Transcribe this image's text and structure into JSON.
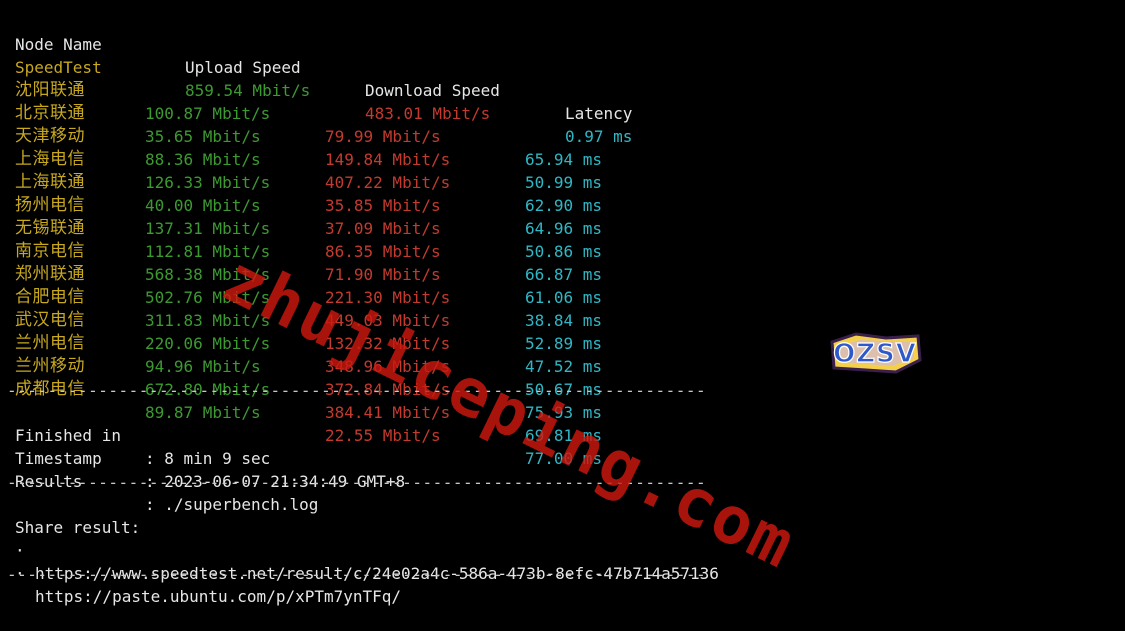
{
  "divider": "-------------------------------------------------------------------------------",
  "headers": {
    "node_name": "Node Name",
    "upload_speed": "Upload Speed",
    "download_speed": "Download Speed",
    "latency": "Latency"
  },
  "rows": [
    {
      "node": "SpeedTest",
      "upload": "859.54 Mbit/s",
      "download": "483.01 Mbit/s",
      "latency": "0.97 ms"
    },
    {
      "node": "沈阳联通",
      "upload": "100.87 Mbit/s",
      "download": "79.99 Mbit/s",
      "latency": "65.94 ms"
    },
    {
      "node": "北京联通",
      "upload": "35.65 Mbit/s",
      "download": "149.84 Mbit/s",
      "latency": "50.99 ms"
    },
    {
      "node": "天津移动",
      "upload": "88.36 Mbit/s",
      "download": "407.22 Mbit/s",
      "latency": "62.90 ms"
    },
    {
      "node": "上海电信",
      "upload": "126.33 Mbit/s",
      "download": "35.85 Mbit/s",
      "latency": "64.96 ms"
    },
    {
      "node": "上海联通",
      "upload": "40.00 Mbit/s",
      "download": "37.09 Mbit/s",
      "latency": "50.86 ms"
    },
    {
      "node": "扬州电信",
      "upload": "137.31 Mbit/s",
      "download": "86.35 Mbit/s",
      "latency": "66.87 ms"
    },
    {
      "node": "无锡联通",
      "upload": "112.81 Mbit/s",
      "download": "71.90 Mbit/s",
      "latency": "61.06 ms"
    },
    {
      "node": "南京电信",
      "upload": "568.38 Mbit/s",
      "download": "221.30 Mbit/s",
      "latency": "38.84 ms"
    },
    {
      "node": "郑州联通",
      "upload": "502.76 Mbit/s",
      "download": "449.03 Mbit/s",
      "latency": "52.89 ms"
    },
    {
      "node": "合肥电信",
      "upload": "311.83 Mbit/s",
      "download": "132.32 Mbit/s",
      "latency": "47.52 ms"
    },
    {
      "node": "武汉电信",
      "upload": "220.06 Mbit/s",
      "download": "348.96 Mbit/s",
      "latency": "50.67 ms"
    },
    {
      "node": "兰州电信",
      "upload": "94.96 Mbit/s",
      "download": "372.84 Mbit/s",
      "latency": "75.93 ms"
    },
    {
      "node": "兰州移动",
      "upload": "672.80 Mbit/s",
      "download": "384.41 Mbit/s",
      "latency": "69.81 ms"
    },
    {
      "node": "成都电信",
      "upload": "89.87 Mbit/s",
      "download": "22.55 Mbit/s",
      "latency": "77.00 ms"
    }
  ],
  "summary": {
    "finished_label": "Finished in",
    "finished_value": ": 8 min 9 sec",
    "timestamp_label": "Timestamp",
    "timestamp_value": ": 2023-06-07 21:34:49 GMT+8",
    "results_label": "Results",
    "results_value": ": ./superbench.log"
  },
  "share": {
    "title": "Share result:",
    "bullet": "·",
    "links": [
      "https://www.speedtest.net/result/c/24e02a4c-586a-473b-8efc-47b714a57136",
      "https://paste.ubuntu.com/p/xPTm7ynTFq/"
    ]
  },
  "watermark": "zhujiceping.com",
  "logo_text": "OZSV",
  "colors": {
    "background": "#000000",
    "node_name": "#c7a81f",
    "upload": "#3c9a31",
    "download": "#c33a2e",
    "latency": "#2fb7c5",
    "text": "#e6e6e6",
    "watermark": "#cd190f"
  }
}
